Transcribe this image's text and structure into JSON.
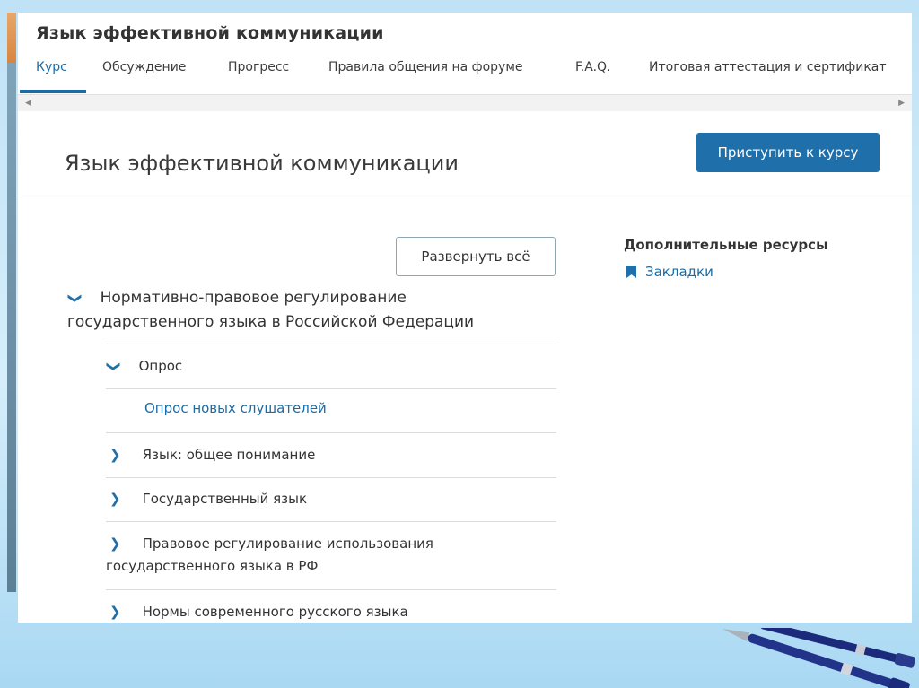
{
  "course_header": {
    "title": "Язык эффективной коммуникации"
  },
  "tabs": [
    {
      "label": "Курс",
      "active": true
    },
    {
      "label": "Обсуждение"
    },
    {
      "label": "Прогресс"
    },
    {
      "label": "Правила общения на форуме"
    },
    {
      "label": "F.A.Q."
    },
    {
      "label": "Итоговая аттестация и сертификат"
    }
  ],
  "page": {
    "title": "Язык эффективной коммуникации",
    "start_button": "Приступить к курсу",
    "expand_all": "Развернуть всё"
  },
  "resources": {
    "title": "Дополнительные ресурсы",
    "bookmarks": "Закладки"
  },
  "outline": {
    "section_title": "Нормативно-правовое регулирование государственного языка в Российской Федерации",
    "subsections": [
      {
        "label": "Опрос",
        "expanded": true,
        "units": [
          "Опрос новых слушателей"
        ]
      },
      {
        "label": "Язык: общее понимание",
        "expanded": false
      },
      {
        "label": "Государственный язык",
        "expanded": false
      },
      {
        "label": "Правовое регулирование использования государственного языка в РФ",
        "expanded": false
      },
      {
        "label": "Нормы современного русского языка",
        "expanded": false
      }
    ]
  },
  "colors": {
    "accent": "#1f6faa",
    "link": "#1a6ca6",
    "text": "#333333"
  },
  "icons": {
    "expanded": "chevron-down-icon",
    "collapsed": "chevron-right-icon",
    "bookmark": "bookmark-icon"
  }
}
